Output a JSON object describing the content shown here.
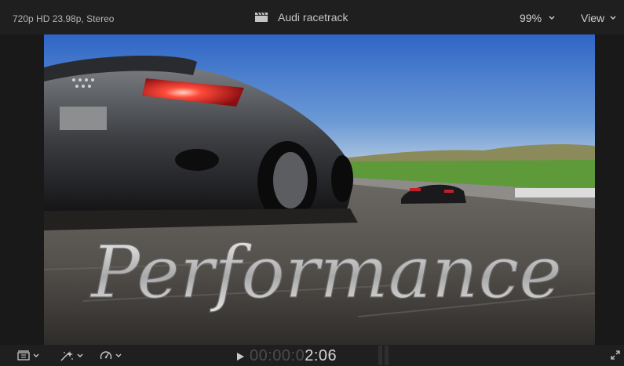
{
  "topbar": {
    "format_label": "720p HD 23.98p, Stereo",
    "clip_icon": "clapperboard-icon",
    "clip_title": "Audi racetrack",
    "zoom_value": "99%",
    "view_label": "View"
  },
  "viewer": {
    "overlay_title": "Performance"
  },
  "bottombar": {
    "timecode_dim": "00:00:0",
    "timecode_lit": "2:06",
    "icons": [
      "transform-menu-icon",
      "effects-menu-icon",
      "retime-menu-icon",
      "play-icon",
      "fullscreen-icon"
    ]
  },
  "colors": {
    "chrome_bg": "#1f1f1f",
    "timecode_inactive": "#4b4b4b",
    "timecode_active": "#d4d4d4"
  }
}
